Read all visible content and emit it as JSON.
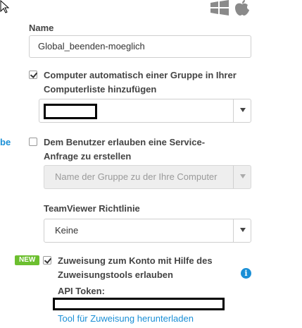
{
  "left_link": "be",
  "name_label": "Name",
  "name_value": "Global_beenden-moeglich",
  "auto_group": {
    "checked": true,
    "label": "Computer automatisch einer Gruppe in Ihrer Computerliste hinzufügen"
  },
  "service_request": {
    "checked": false,
    "label": "Dem Benutzer erlauben eine Service-Anfrage zu erstellen",
    "group_placeholder": "Name der Gruppe zu der Ihre Computer"
  },
  "policy": {
    "label": "TeamViewer Richtlinie",
    "value": "Keine"
  },
  "assignment": {
    "badge": "NEW",
    "checked": true,
    "label": "Zuweisung zum Konto mit Hilfe des Zuweisungstools erlauben",
    "api_token_label": "API Token:",
    "download_link": "Tool für Zuweisung herunterladen",
    "info_icon": "i"
  },
  "icons": [
    "cursor-icon",
    "windows-icon",
    "apple-icon",
    "chevron-down-icon",
    "info-icon"
  ],
  "colors": {
    "accent": "#1a8fd6",
    "badge": "#6cbf2f"
  }
}
